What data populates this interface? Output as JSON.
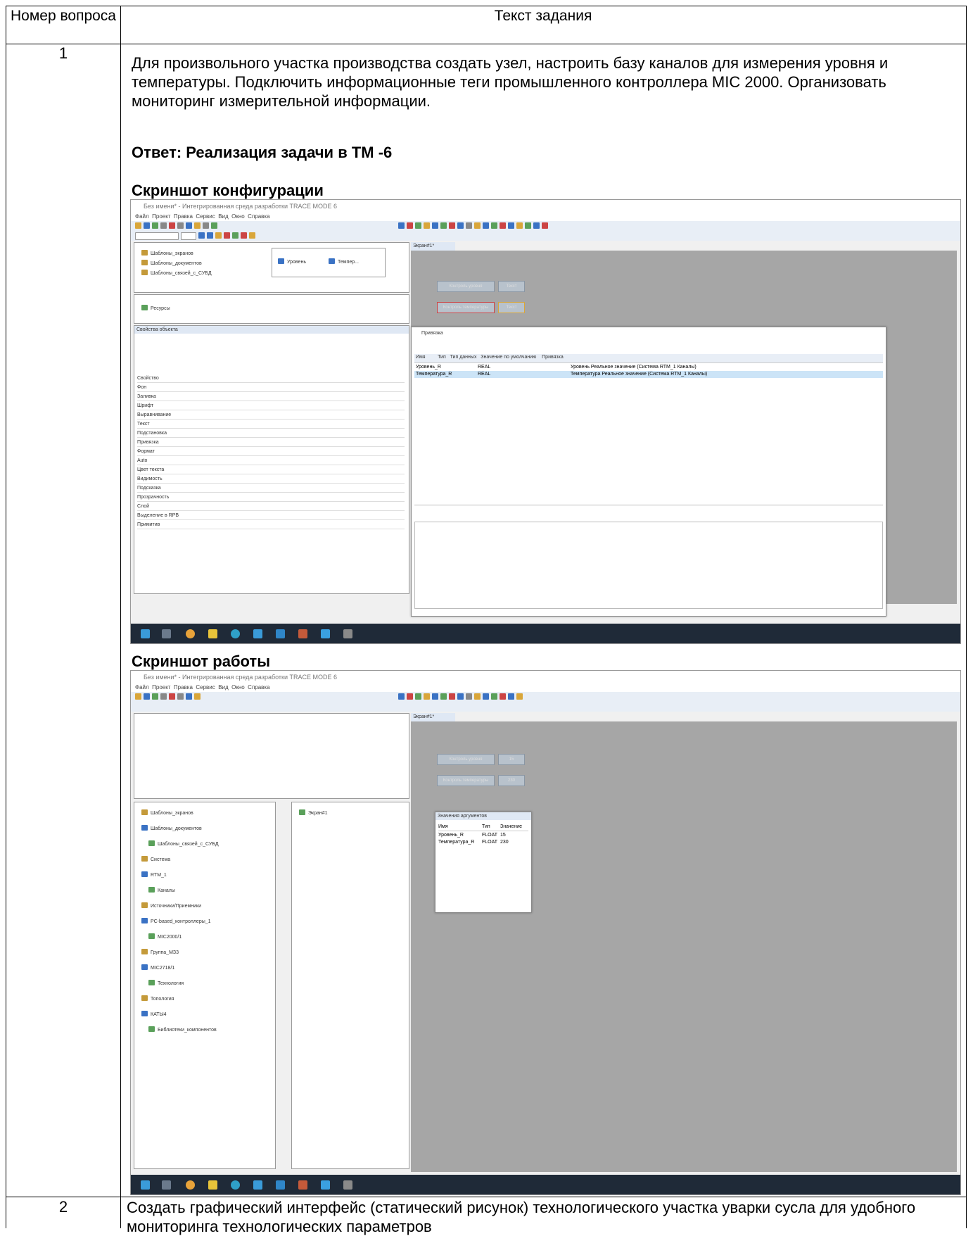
{
  "header": {
    "col1": "Номер вопроса",
    "col2": "Текст задания"
  },
  "row1": {
    "number": "1",
    "task": "Для произвольного участка производства создать узел, настроить базу каналов для измерения уровня и температуры. Подключить информационные теги промышленного контроллера MIC 2000. Организовать мониторинг измерительной информации.",
    "answer": "Ответ: Реализация задачи в TM -6",
    "config_caption": "Скриншот конфигурации",
    "run_caption": "Скриншот работы"
  },
  "row2": {
    "number": "2",
    "task": " Создать графический интерфейс (статический рисунок) технологического участка уварки сусла для удобного мониторинга технологических параметров"
  },
  "shot1": {
    "dialog_title": "Привязка",
    "rows": [
      {
        "name": "Уровень_R",
        "type": "REAL",
        "link": "Уровень Реальное значение (Система RTM_1 Каналы)"
      },
      {
        "name": "Температура_R",
        "type": "REAL",
        "link": "Температура Реальное значение (Система RTM_1 Каналы)"
      }
    ],
    "tabs": [
      "Уровень",
      "Темпер..."
    ],
    "screen_tab": "Экран#1*",
    "btn_level": "Контроль уровня",
    "btn_temp": "Контроль температуры",
    "value_label": "Текст",
    "props": [
      "Свойство",
      "Фон",
      "Заливка",
      "Шрифт",
      "Выравнивание",
      "Текст",
      "Подстановка",
      "Привязка",
      "Формат",
      "Auto",
      "Цвет текста",
      "Видимость",
      "Подсказка",
      "Прозрачность",
      "Слой",
      "Выделение в RPB",
      "Примитив"
    ]
  },
  "shot2": {
    "screen_tab": "Экран#1*",
    "btn_level": "Контроль уровня",
    "btn_temp": "Контроль температуры",
    "value_level": "15",
    "value_temp": "230",
    "table_title": "Значения аргументов",
    "table_header": [
      "Имя",
      "Тип",
      "Значение"
    ],
    "table_rows": [
      [
        "Уровень_R",
        "FLOAT",
        "15"
      ],
      [
        "Температура_R",
        "FLOAT",
        "230"
      ]
    ],
    "tree": [
      "Шаблоны_экранов",
      "Шаблоны_документов",
      "Шаблоны_связей_с_СУБД",
      "Система",
      "RTM_1",
      "Каналы",
      "Источники/Приемники",
      "PC-based_контроллеры_1",
      "MIC2000/1",
      "Группа_МЗ3",
      "MIC2718/1",
      "Технология",
      "Топология",
      "КАТЫ4",
      "Библиотеки_компонентов"
    ]
  },
  "colors": {
    "workarea": "#a6a6a6",
    "taskbar": "#1f2a38",
    "selection": "#cce4f7"
  }
}
